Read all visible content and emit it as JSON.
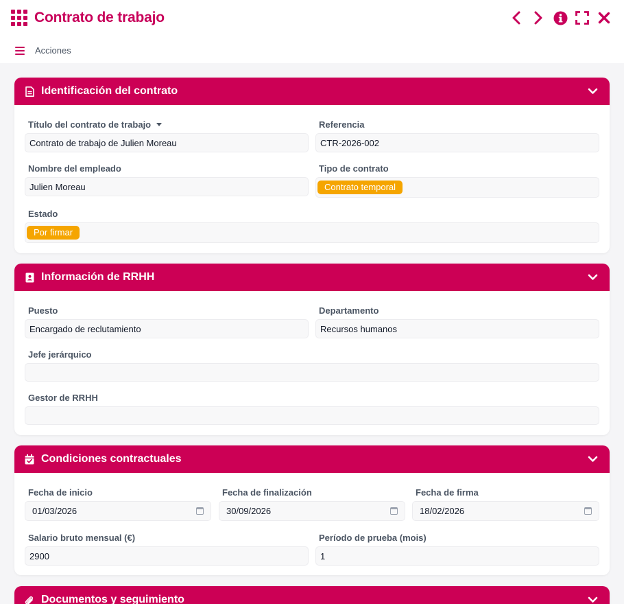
{
  "window": {
    "title": "Contrato de trabajo",
    "actions_label": "Acciones",
    "accent": "#c8005a"
  },
  "sections": {
    "identificacion": {
      "title": "Identificación del contrato",
      "fields": {
        "titulo": {
          "label": "Título del contrato de trabajo",
          "value": "Contrato de trabajo de Julien Moreau"
        },
        "referencia": {
          "label": "Referencia",
          "value": "CTR-2026-002"
        },
        "empleado": {
          "label": "Nombre del empleado",
          "value": "Julien Moreau"
        },
        "tipo": {
          "label": "Tipo de contrato",
          "value": "Contrato temporal"
        },
        "estado": {
          "label": "Estado",
          "value": "Por firmar"
        }
      }
    },
    "rrhh": {
      "title": "Información de RRHH",
      "fields": {
        "puesto": {
          "label": "Puesto",
          "value": "Encargado de reclutamiento"
        },
        "departamento": {
          "label": "Departamento",
          "value": "Recursos humanos"
        },
        "jefe": {
          "label": "Jefe jerárquico",
          "value": ""
        },
        "gestor": {
          "label": "Gestor de RRHH",
          "value": ""
        }
      }
    },
    "condiciones": {
      "title": "Condiciones contractuales",
      "fields": {
        "inicio": {
          "label": "Fecha de inicio",
          "value": "01/03/2026"
        },
        "fin": {
          "label": "Fecha de finalización",
          "value": "30/09/2026"
        },
        "firma": {
          "label": "Fecha de firma",
          "value": "18/02/2026"
        },
        "salario": {
          "label": "Salario bruto mensual (€)",
          "value": "2900"
        },
        "prueba": {
          "label": "Período de prueba (mois)",
          "value": "1"
        }
      }
    },
    "documentos": {
      "title": "Documentos y seguimiento"
    }
  },
  "colors": {
    "header": "#cc0055",
    "badge": "#f5a500"
  }
}
